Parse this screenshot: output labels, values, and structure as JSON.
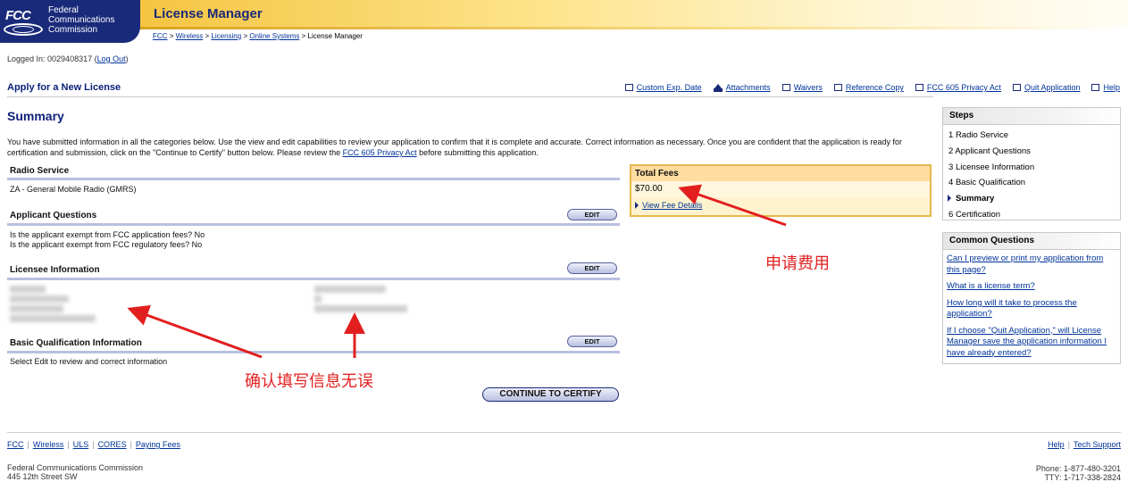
{
  "header": {
    "logo_text": "FCC",
    "agency_line1": "Federal",
    "agency_line2": "Communications",
    "agency_line3": "Commission",
    "app_title": "License Manager",
    "breadcrumb": [
      "FCC",
      "Wireless",
      "Licensing",
      "Online Systems"
    ],
    "breadcrumb_current": "License Manager",
    "breadcrumb_sep": ">"
  },
  "session": {
    "logged_in_label": "Logged In: 0029408317 (",
    "logout_label": "Log Out",
    "logged_in_close": ")"
  },
  "page": {
    "heading": "Apply for a New License",
    "summary_title": "Summary",
    "intro_text": "You have submitted information in all the categories below. Use the view and edit capabilities to review your application to confirm that it is complete and accurate. Correct information as necessary. Once you are confident that the application is ready for certification and submission, click on the \"Continue to Certify\" button below. Please review the ",
    "intro_link": "FCC 605 Privacy Act",
    "intro_after": " before submitting this application."
  },
  "toolbar": [
    {
      "label": "Custom Exp. Date",
      "icon": "calendar-icon"
    },
    {
      "label": "Attachments",
      "icon": "upload-icon"
    },
    {
      "label": "Waivers",
      "icon": "waiver-icon"
    },
    {
      "label": "Reference Copy",
      "icon": "copy-icon"
    },
    {
      "label": "FCC 605 Privacy Act",
      "icon": "document-icon"
    },
    {
      "label": "Quit Application",
      "icon": "close-icon"
    },
    {
      "label": "Help",
      "icon": "help-icon"
    }
  ],
  "sections": {
    "radio_service": {
      "title": "Radio Service",
      "value": "ZA - General Mobile Radio (GMRS)"
    },
    "applicant_questions": {
      "title": "Applicant Questions",
      "edit_label": "EDIT",
      "line1": "Is the applicant exempt from FCC application fees? No",
      "line2": "Is the applicant exempt from FCC regulatory fees? No"
    },
    "licensee_info": {
      "title": "Licensee Information",
      "edit_label": "EDIT"
    },
    "basic_qualification": {
      "title": "Basic Qualification Information",
      "edit_label": "EDIT",
      "text": "Select Edit to review and correct information"
    }
  },
  "fees": {
    "title": "Total Fees",
    "amount": "$70.00",
    "details_link": "View Fee Details"
  },
  "continue_label": "CONTINUE TO CERTIFY",
  "steps": {
    "title": "Steps",
    "items": [
      {
        "num": "1",
        "label": "Radio Service"
      },
      {
        "num": "2",
        "label": "Applicant Questions"
      },
      {
        "num": "3",
        "label": "Licensee Information"
      },
      {
        "num": "4",
        "label": "Basic Qualification"
      },
      {
        "num": "5",
        "label": "Summary"
      },
      {
        "num": "6",
        "label": "Certification"
      }
    ]
  },
  "common_questions": {
    "title": "Common Questions",
    "items": [
      "Can I preview or print my application from this page?",
      "What is a license term?",
      "How long will it take to process the application?",
      "If I choose \"Quit Application,\" will License Manager save the application information I have already entered?"
    ]
  },
  "annotations": {
    "fee_note": "申请费用",
    "confirm_note": "确认填写信息无误",
    "color": "#e21f1f"
  },
  "footer": {
    "links": [
      "FCC",
      "Wireless",
      "ULS",
      "CORES",
      "Paying Fees"
    ],
    "right_links": [
      "Help",
      "Tech Support"
    ],
    "address_line1": "Federal Communications Commission",
    "address_line2": "445 12th Street SW",
    "phone_line1": "Phone: 1-877-480-3201",
    "phone_line2": "TTY: 1-717-338-2824"
  }
}
